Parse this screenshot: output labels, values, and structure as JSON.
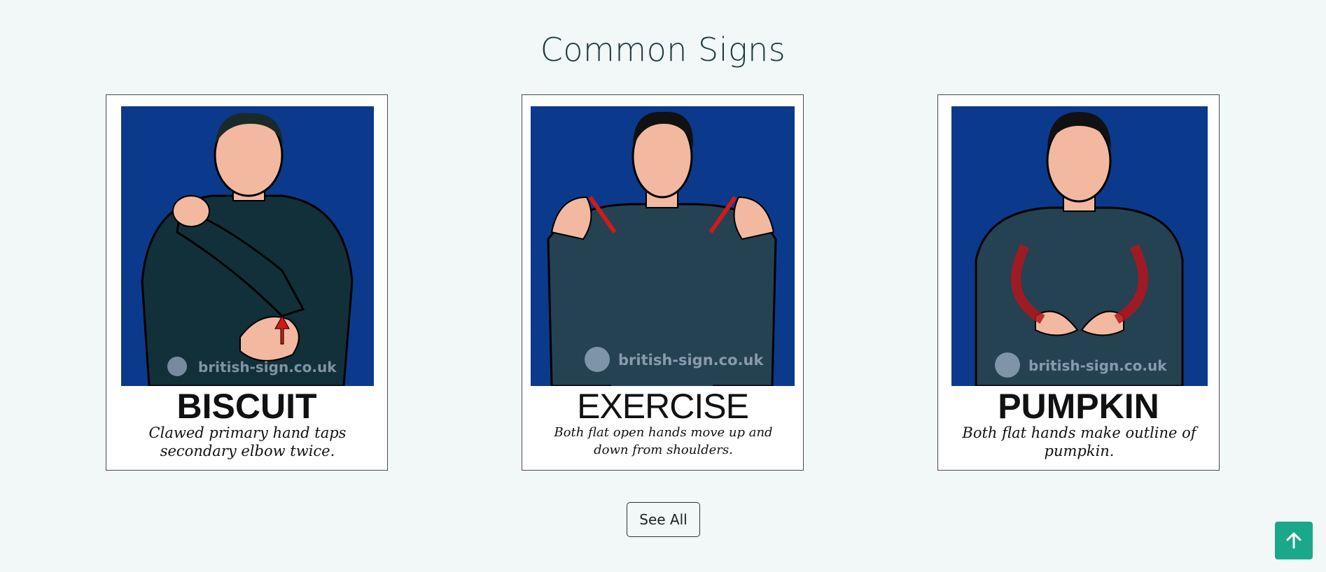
{
  "section": {
    "title": "Common Signs"
  },
  "cards": [
    {
      "word": "BISCUIT",
      "description": "Clawed primary hand taps secondary elbow twice.",
      "watermark": "british-sign.co.uk"
    },
    {
      "word": "EXERCISE",
      "description": "Both flat open hands move up and down from shoulders.",
      "watermark": "british-sign.co.uk"
    },
    {
      "word": "PUMPKIN",
      "description": "Both flat hands make outline of pumpkin.",
      "watermark": "british-sign.co.uk"
    }
  ],
  "actions": {
    "see_all_label": "See All",
    "back_to_top_icon": "arrow-up-icon"
  },
  "colors": {
    "image_background": "#0b3a8c",
    "accent": "#1aa88a",
    "arrow_red": "#d11a1a"
  }
}
